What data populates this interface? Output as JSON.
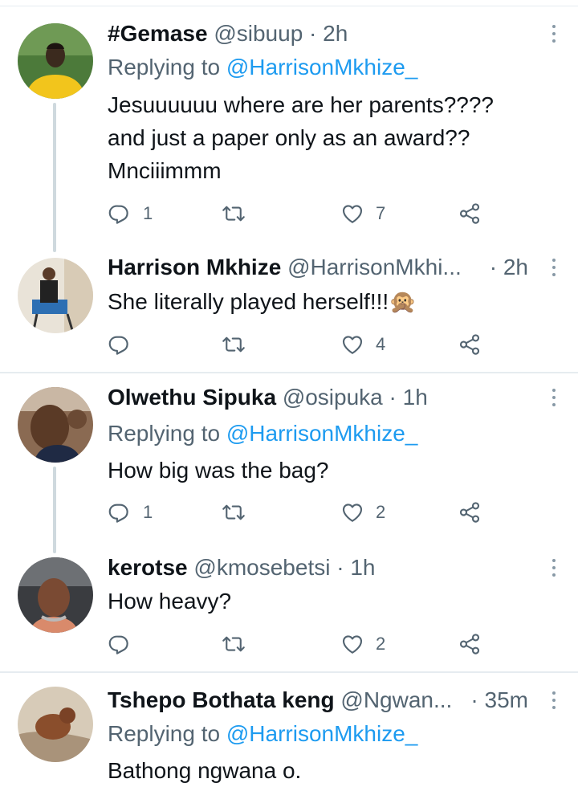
{
  "tweets": [
    {
      "name": "#Gemase",
      "handle": "@sibuup",
      "time": "2h",
      "reply_label": "Replying to",
      "reply_to": "@HarrisonMkhize_",
      "text_lines": [
        "Jesuuuuuu where are her parents????",
        "and just a paper only as an award??",
        "Mnciiimmm"
      ],
      "replies": "1",
      "retweets": "",
      "likes": "7"
    },
    {
      "name": "Harrison Mkhize",
      "handle": "@HarrisonMkhi...",
      "time": "2h",
      "text_lines": [
        "She literally played herself!!!"
      ],
      "emoji": "🙊",
      "replies": "",
      "retweets": "",
      "likes": "4"
    },
    {
      "name": "Olwethu Sipuka",
      "handle": "@osipuka",
      "time": "1h",
      "reply_label": "Replying to",
      "reply_to": "@HarrisonMkhize_",
      "text_lines": [
        "How big was the bag?"
      ],
      "replies": "1",
      "retweets": "",
      "likes": "2"
    },
    {
      "name": "kerotse",
      "handle": "@kmosebetsi",
      "time": "1h",
      "text_lines": [
        "How heavy?"
      ],
      "replies": "",
      "retweets": "",
      "likes": "2"
    },
    {
      "name": "Tshepo Bothata keng",
      "handle": "@Ngwan...",
      "time": "35m",
      "reply_label": "Replying to",
      "reply_to": "@HarrisonMkhize_",
      "text_lines": [
        "Bathong ngwana o."
      ]
    }
  ],
  "separator": "·",
  "icons": {
    "reply": "reply-icon",
    "retweet": "retweet-icon",
    "like": "heart-icon",
    "share": "share-icon",
    "more": "more-vertical-icon"
  },
  "colors": {
    "text": "#0f1419",
    "secondary": "#536471",
    "link": "#1d9bf0",
    "icon": "#536471",
    "divider": "#e6ecf0"
  }
}
